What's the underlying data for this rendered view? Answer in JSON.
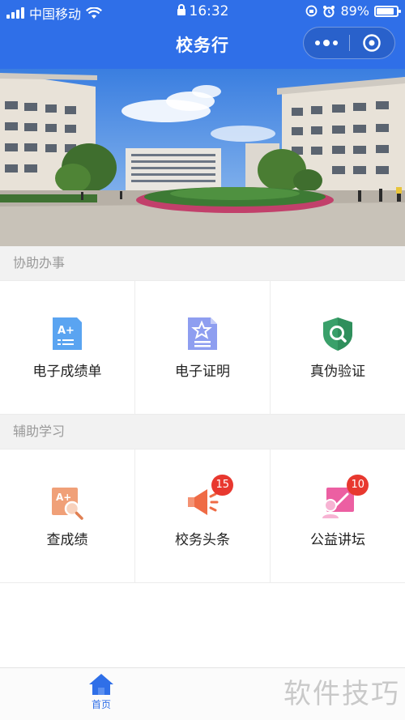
{
  "status_bar": {
    "carrier": "中国移动",
    "time": "16:32",
    "battery": "89%"
  },
  "nav": {
    "title": "校务行"
  },
  "sections": [
    {
      "label": "协助办事",
      "items": [
        {
          "label": "电子成绩单",
          "icon": "transcript-icon"
        },
        {
          "label": "电子证明",
          "icon": "certificate-icon"
        },
        {
          "label": "真伪验证",
          "icon": "verify-shield-icon"
        }
      ]
    },
    {
      "label": "辅助学习",
      "items": [
        {
          "label": "查成绩",
          "icon": "grade-search-icon"
        },
        {
          "label": "校务头条",
          "icon": "megaphone-icon",
          "badge": "15"
        },
        {
          "label": "公益讲坛",
          "icon": "lecture-icon",
          "badge": "10"
        }
      ]
    }
  ],
  "tabbar": {
    "home_label": "首页"
  },
  "watermark": "软件技巧",
  "colors": {
    "primary": "#2f6fe8",
    "badge": "#e8382f"
  }
}
